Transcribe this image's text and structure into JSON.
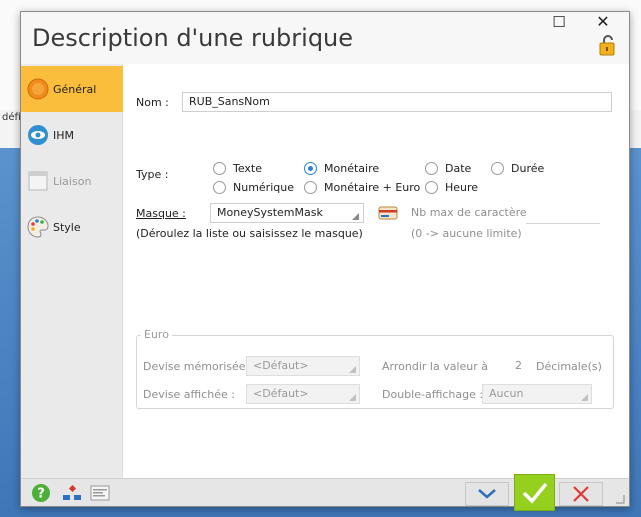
{
  "background": {
    "partial_text": "défi"
  },
  "dialog": {
    "title": "Description d'une rubrique",
    "window_controls": {
      "maximize": "☐",
      "close": "✕"
    }
  },
  "sidebar": {
    "items": [
      {
        "label": "Général",
        "icon": "general-icon",
        "active": true,
        "enabled": true
      },
      {
        "label": "IHM",
        "icon": "eye-icon",
        "active": false,
        "enabled": true
      },
      {
        "label": "Liaison",
        "icon": "link-window-icon",
        "active": false,
        "enabled": false
      },
      {
        "label": "Style",
        "icon": "palette-icon",
        "active": false,
        "enabled": true
      }
    ]
  },
  "form": {
    "nom_label": "Nom :",
    "nom_value": "RUB_SansNom",
    "type_label": "Type :",
    "type_options": [
      {
        "label": "Texte",
        "checked": false
      },
      {
        "label": "Monétaire",
        "checked": true
      },
      {
        "label": "Date",
        "checked": false
      },
      {
        "label": "Durée",
        "checked": false
      },
      {
        "label": "Numérique",
        "checked": false
      },
      {
        "label": "Monétaire + Euro",
        "checked": false
      },
      {
        "label": "Heure",
        "checked": false
      }
    ],
    "masque_label": "Masque :",
    "masque_value": "MoneySystemMask",
    "masque_hint": "(Déroulez la liste ou saisissez le masque)",
    "nbmax_label": "Nb max de caractères",
    "nbmax_hint": "(0 -> aucune limite)",
    "nbmax_value": ""
  },
  "euro": {
    "group_label": "Euro",
    "devise_memorisee_label": "Devise mémorisée :",
    "devise_memorisee_value": "<Défaut>",
    "devise_affichee_label": "Devise affichée :",
    "devise_affichee_value": "<Défaut>",
    "arrondir_label": "Arrondir la valeur à :",
    "arrondir_value": "2",
    "decimales_label": "Décimale(s)",
    "double_affichage_label": "Double-affichage :",
    "double_affichage_value": "Aucun"
  },
  "bottombar": {
    "icons": [
      "help-icon",
      "structure-icon",
      "description-icon"
    ]
  },
  "colors": {
    "active_tab": "#fbbd3c",
    "ok_button": "#96d01e",
    "radio_accent": "#2a82da",
    "cancel_x": "#e03a3a",
    "down_chevron": "#2f6fb8"
  }
}
